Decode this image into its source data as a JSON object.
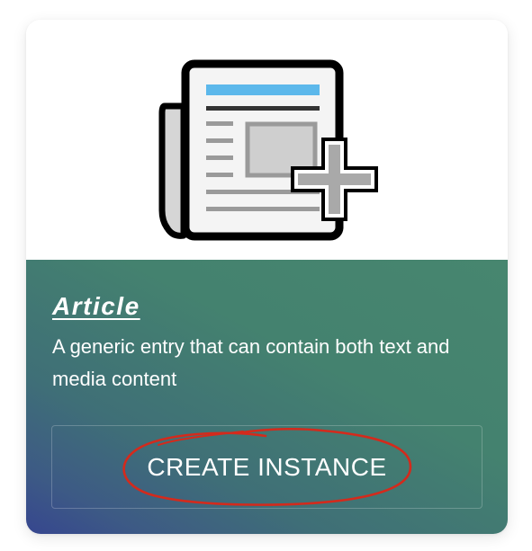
{
  "card": {
    "title": "Article",
    "description": "A generic entry that can contain both text and media content",
    "button_label": "CREATE INSTANCE",
    "icon": "newspaper-add-icon"
  },
  "colors": {
    "gradient_top": "#47866f",
    "gradient_bottom_left": "#36468f",
    "annotation_stroke": "#d42a1c",
    "icon_accent": "#5cb8eb"
  }
}
